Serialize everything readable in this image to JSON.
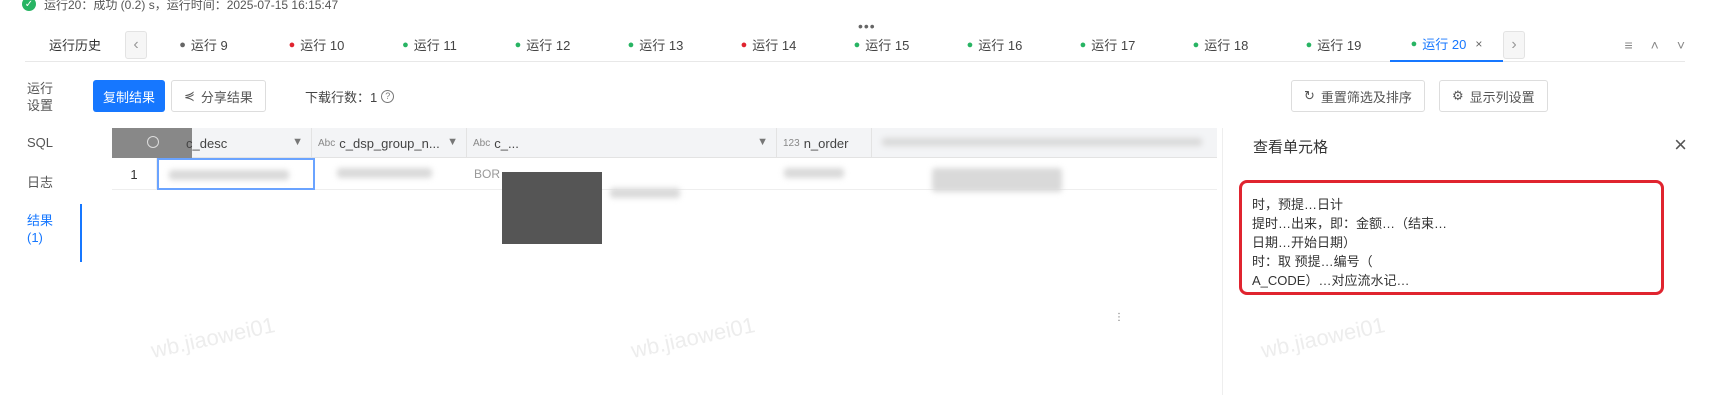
{
  "status": {
    "text": "运行20：成功 (0.2) s，运行时间：2025-07-15 16:15:47",
    "dots": "•••"
  },
  "tabbar": {
    "history_label": "运行历史",
    "prev_arrow": "‹",
    "next_arrow": "›",
    "runs": [
      {
        "label": "运行 9",
        "status": "neutral",
        "color": "#666666"
      },
      {
        "label": "运行 10",
        "status": "error",
        "color": "#e0242f"
      },
      {
        "label": "运行 11",
        "status": "success",
        "color": "#28b463"
      },
      {
        "label": "运行 12",
        "status": "success",
        "color": "#28b463"
      },
      {
        "label": "运行 13",
        "status": "success",
        "color": "#28b463"
      },
      {
        "label": "运行 14",
        "status": "error",
        "color": "#e0242f"
      },
      {
        "label": "运行 15",
        "status": "success",
        "color": "#28b463"
      },
      {
        "label": "运行 16",
        "status": "success",
        "color": "#28b463"
      },
      {
        "label": "运行 17",
        "status": "success",
        "color": "#28b463"
      },
      {
        "label": "运行 18",
        "status": "success",
        "color": "#28b463"
      },
      {
        "label": "运行 19",
        "status": "success",
        "color": "#28b463"
      },
      {
        "label": "运行 20",
        "status": "success",
        "color": "#28b463",
        "active": true
      }
    ],
    "close_icon": "×",
    "menu_icon": "≡",
    "up_icon": "˄",
    "down_icon": "˅"
  },
  "sidenav": {
    "items": [
      {
        "label": "运行\n设置"
      },
      {
        "label": "SQL"
      },
      {
        "label": "日志"
      },
      {
        "label": "结果\n(1)",
        "active": true
      }
    ]
  },
  "toolbar": {
    "copy_label": "复制结果",
    "share_label": "分享结果",
    "download_rows_label": "下载行数：1",
    "reset_label": "重置筛选及排序",
    "columns_label": "显示列设置"
  },
  "grid": {
    "columns": [
      {
        "type": "",
        "name": "c_desc"
      },
      {
        "type": "Abc",
        "name": "c_dsp_group_n..."
      },
      {
        "type": "Abc",
        "name": "c_..."
      },
      {
        "type": "123",
        "name": "n_order"
      },
      {
        "type": "",
        "name": ""
      }
    ],
    "rows": [
      {
        "num": "1",
        "col3_prefix": "BOR"
      }
    ]
  },
  "panel": {
    "title": "查看单元格",
    "content_lines": [
      "时，预提…日计",
      "提时…出来，即：金额…（结束…",
      "日期…开始日期）",
      "时：取 预提…编号（",
      "A_CODE）…对应流水记…"
    ]
  },
  "watermark": "wb.jiaowei01",
  "colors": {
    "accent": "#1677ff",
    "success": "#28b463",
    "error": "#e0242f",
    "highlight_border": "#e0242f"
  }
}
